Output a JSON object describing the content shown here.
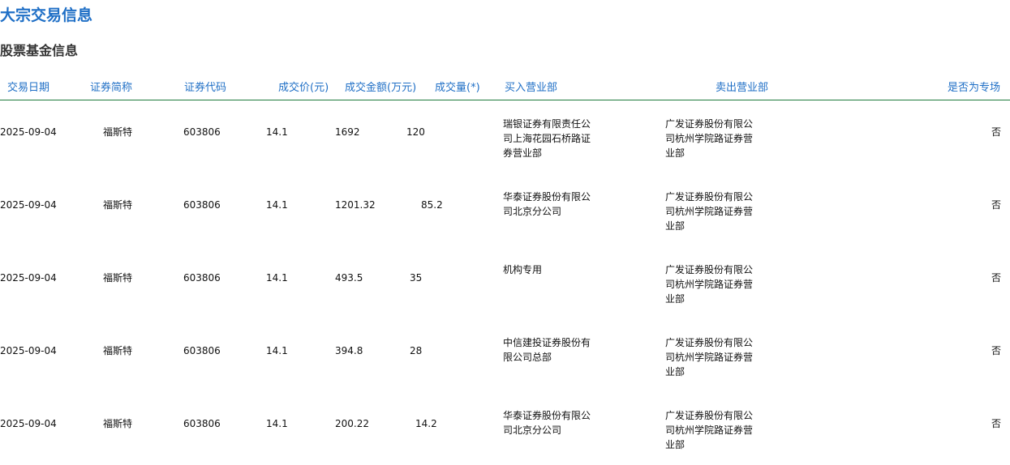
{
  "page_title": "大宗交易信息",
  "section_title": "股票基金信息",
  "columns": [
    "交易日期",
    "证券简称",
    "证券代码",
    "成交价(元)",
    "成交金额(万元)",
    "成交量(*)",
    "买入营业部",
    "卖出营业部",
    "是否为专场"
  ],
  "colors": {
    "title": "#1f6fc6",
    "header_text": "#1f6fc6",
    "header_border": "#1e7a3c"
  },
  "rows": [
    {
      "date": "2025-09-04",
      "name": "福斯特",
      "code": "603806",
      "price": "14.1",
      "amount": "1692",
      "volume": "120",
      "buyer": "瑞银证券有限责任公司上海花园石桥路证券营业部",
      "seller": "广发证券股份有限公司杭州学院路证券营业部",
      "special": "否"
    },
    {
      "date": "2025-09-04",
      "name": "福斯特",
      "code": "603806",
      "price": "14.1",
      "amount": "1201.32",
      "volume": "85.2",
      "buyer": "华泰证券股份有限公司北京分公司",
      "seller": "广发证券股份有限公司杭州学院路证券营业部",
      "special": "否"
    },
    {
      "date": "2025-09-04",
      "name": "福斯特",
      "code": "603806",
      "price": "14.1",
      "amount": "493.5",
      "volume": "35",
      "buyer": "机构专用",
      "seller": "广发证券股份有限公司杭州学院路证券营业部",
      "special": "否"
    },
    {
      "date": "2025-09-04",
      "name": "福斯特",
      "code": "603806",
      "price": "14.1",
      "amount": "394.8",
      "volume": "28",
      "buyer": "中信建投证券股份有限公司总部",
      "seller": "广发证券股份有限公司杭州学院路证券营业部",
      "special": "否"
    },
    {
      "date": "2025-09-04",
      "name": "福斯特",
      "code": "603806",
      "price": "14.1",
      "amount": "200.22",
      "volume": "14.2",
      "buyer": "华泰证券股份有限公司北京分公司",
      "seller": "广发证券股份有限公司杭州学院路证券营业部",
      "special": "否"
    }
  ]
}
